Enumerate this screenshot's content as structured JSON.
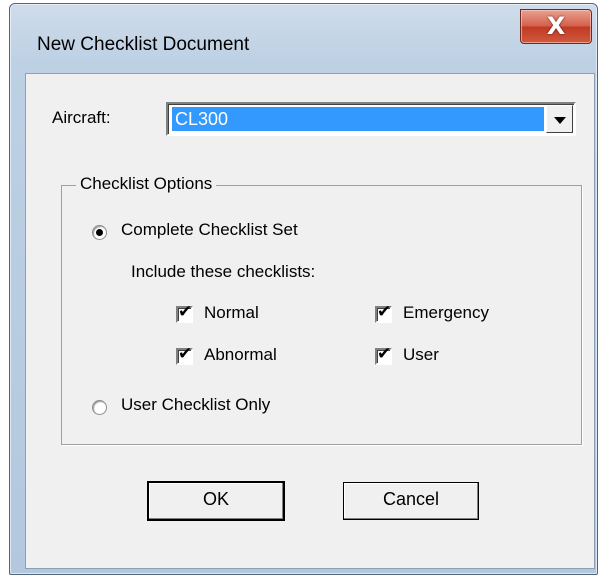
{
  "window": {
    "title": "New Checklist Document",
    "close_glyph": "X"
  },
  "aircraft": {
    "label": "Aircraft:",
    "selected": "CL300"
  },
  "options": {
    "group_title": "Checklist Options",
    "complete_set": {
      "label": "Complete Checklist Set",
      "selected": true
    },
    "include_label": "Include these checklists:",
    "checklists": [
      {
        "label": "Normal",
        "checked": true
      },
      {
        "label": "Emergency",
        "checked": true
      },
      {
        "label": "Abnormal",
        "checked": true
      },
      {
        "label": "User",
        "checked": true
      }
    ],
    "user_only": {
      "label": "User Checklist Only",
      "selected": false
    }
  },
  "buttons": {
    "ok": "OK",
    "cancel": "Cancel"
  }
}
